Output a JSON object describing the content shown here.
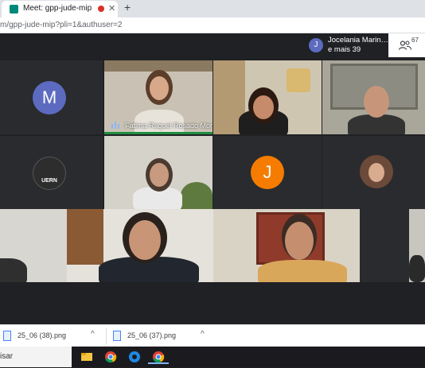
{
  "browser": {
    "tab_title": "Meet: gpp-jude-mip",
    "tab_close": "✕",
    "new_tab": "+",
    "url": "m/gpp-jude-mip?pli=1&authuser=2"
  },
  "meet": {
    "participants_name_line1": "Jocelania Marin…",
    "participants_name_line2": "e mais 39",
    "participants_avatar_letter": "J",
    "participant_count": "67",
    "tiles": [
      {
        "kind": "avatar",
        "letter": "M",
        "color": "#5c6bc0"
      },
      {
        "kind": "video",
        "name": "Fatima Raquel Rosado Mor…",
        "speaking": true
      },
      {
        "kind": "video"
      },
      {
        "kind": "video"
      },
      {
        "kind": "logo",
        "logo_text": "UERN"
      },
      {
        "kind": "video"
      },
      {
        "kind": "avatar",
        "letter": "J",
        "color": "#f57c00"
      },
      {
        "kind": "photo"
      },
      {
        "kind": "video"
      },
      {
        "kind": "video"
      },
      {
        "kind": "video"
      },
      {
        "kind": "video"
      }
    ]
  },
  "downloads": [
    {
      "name": "25_06 (38).png",
      "caret": "^"
    },
    {
      "name": "25_06 (37).png",
      "caret": "^"
    }
  ],
  "taskbar": {
    "search_text": "isar"
  },
  "colors": {
    "meet_bg": "#202124",
    "speaking_green": "#1e8e3e"
  }
}
